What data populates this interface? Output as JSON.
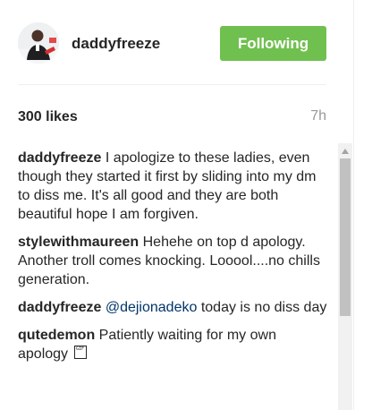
{
  "post": {
    "username": "daddyfreeze",
    "follow_label": "Following",
    "likes": "300 likes",
    "time": "7h"
  },
  "comments": [
    {
      "user": "daddyfreeze",
      "text": "I apologize to these ladies, even though they started it first by sliding into my dm to diss me. It's all good and they are both beautiful hope I am forgiven."
    },
    {
      "user": "stylewithmaureen",
      "text": "Hehehe on top d apology. Another troll comes knocking. Looool....no chills generation."
    },
    {
      "user": "daddyfreeze",
      "mention": "@dejionadeko",
      "text": "today is no diss day"
    },
    {
      "user": "qutedemon",
      "text": "Patiently waiting for my own apology",
      "badge": "GIF"
    }
  ],
  "colors": {
    "follow_button": "#70c050",
    "mention": "#003569",
    "time": "#999999"
  },
  "icons": {
    "avatar": "avatar-photo",
    "scroll_up": "triangle-up-icon",
    "badge": "gif-badge-icon"
  }
}
